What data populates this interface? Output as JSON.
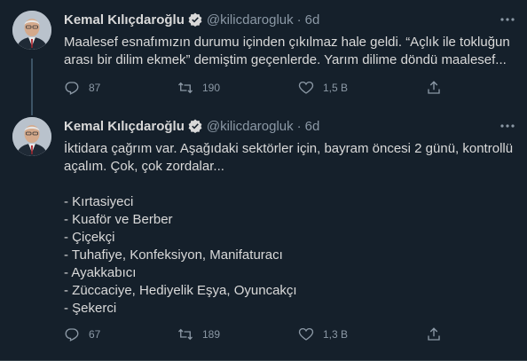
{
  "tweets": [
    {
      "name": "Kemal Kılıçdaroğlu",
      "handle": "@kilicdarogluk",
      "separator": "·",
      "time": "6d",
      "text": "Maalesef esnafımızın durumu içinden çıkılmaz hale geldi. “Açlık ile tokluğun arası bir dilim ekmek” demiştim geçenlerde. Yarım dilime döndü maalesef...",
      "replies": "87",
      "retweets": "190",
      "likes": "1,5 B",
      "icons": {
        "verified": "verified-badge-icon",
        "more": "more-options-icon",
        "reply": "reply-icon",
        "retweet": "retweet-icon",
        "like": "like-icon",
        "share": "share-icon"
      }
    },
    {
      "name": "Kemal Kılıçdaroğlu",
      "handle": "@kilicdarogluk",
      "separator": "·",
      "time": "6d",
      "text": "İktidara çağrım var. Aşağıdaki sektörler için, bayram öncesi 2 günü, kontrollü açalım. Çok, çok zordalar...\n\n- Kırtasiyeci\n- Kuaför ve Berber\n- Çiçekçi\n- Tuhafiye, Konfeksiyon, Manifaturacı\n- Ayakkabıcı\n- Züccaciye, Hediyelik Eşya, Oyuncakçı\n- Şekerci",
      "replies": "67",
      "retweets": "189",
      "likes": "1,3 B",
      "icons": {
        "verified": "verified-badge-icon",
        "more": "more-options-icon",
        "reply": "reply-icon",
        "retweet": "retweet-icon",
        "like": "like-icon",
        "share": "share-icon"
      }
    }
  ],
  "colors": {
    "background": "#15202b",
    "text": "#d9d9d9",
    "secondary": "#8b98a5",
    "verified": "#1d9bf0",
    "thread_line": "#3d5466"
  }
}
